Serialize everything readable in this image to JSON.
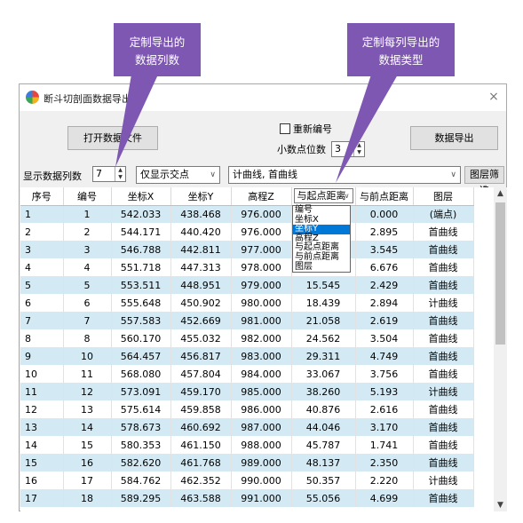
{
  "callouts": {
    "columns": {
      "line1": "定制导出的",
      "line2": "数据列数"
    },
    "types": {
      "line1": "定制每列导出的",
      "line2": "数据类型"
    }
  },
  "window": {
    "title": "断斗切剖面数据导出V",
    "close": "×"
  },
  "toolbar": {
    "open_label": "打开数据文件",
    "renumber_label": "重新编号",
    "decimals_label": "小数点位数",
    "decimals_value": "3",
    "export_label": "数据导出"
  },
  "filters": {
    "columns_label": "显示数据列数",
    "columns_value": "7",
    "point_filter": "仅显示交点",
    "layer_filter": "计曲线, 首曲线",
    "layer_filter_button": "图层筛选"
  },
  "table": {
    "headers": [
      "序号",
      "编号",
      "坐标X",
      "坐标Y",
      "高程Z",
      "与起点距离",
      "与前点距离",
      "图层"
    ],
    "rows": [
      [
        "1",
        "1",
        "542.033",
        "438.468",
        "976.000",
        "",
        "0.000",
        "(端点)"
      ],
      [
        "2",
        "2",
        "544.171",
        "440.420",
        "976.000",
        "",
        "2.895",
        "首曲线"
      ],
      [
        "3",
        "3",
        "546.788",
        "442.811",
        "977.000",
        "",
        "3.545",
        "首曲线"
      ],
      [
        "4",
        "4",
        "551.718",
        "447.313",
        "978.000",
        "",
        "6.676",
        "首曲线"
      ],
      [
        "5",
        "5",
        "553.511",
        "448.951",
        "979.000",
        "15.545",
        "2.429",
        "首曲线"
      ],
      [
        "6",
        "6",
        "555.648",
        "450.902",
        "980.000",
        "18.439",
        "2.894",
        "计曲线"
      ],
      [
        "7",
        "7",
        "557.583",
        "452.669",
        "981.000",
        "21.058",
        "2.619",
        "首曲线"
      ],
      [
        "8",
        "8",
        "560.170",
        "455.032",
        "982.000",
        "24.562",
        "3.504",
        "首曲线"
      ],
      [
        "9",
        "10",
        "564.457",
        "456.817",
        "983.000",
        "29.311",
        "4.749",
        "首曲线"
      ],
      [
        "10",
        "11",
        "568.080",
        "457.804",
        "984.000",
        "33.067",
        "3.756",
        "首曲线"
      ],
      [
        "11",
        "12",
        "573.091",
        "459.170",
        "985.000",
        "38.260",
        "5.193",
        "计曲线"
      ],
      [
        "12",
        "13",
        "575.614",
        "459.858",
        "986.000",
        "40.876",
        "2.616",
        "首曲线"
      ],
      [
        "13",
        "14",
        "578.673",
        "460.692",
        "987.000",
        "44.046",
        "3.170",
        "首曲线"
      ],
      [
        "14",
        "15",
        "580.353",
        "461.150",
        "988.000",
        "45.787",
        "1.741",
        "首曲线"
      ],
      [
        "15",
        "16",
        "582.620",
        "461.768",
        "989.000",
        "48.137",
        "2.350",
        "首曲线"
      ],
      [
        "16",
        "17",
        "584.762",
        "462.352",
        "990.000",
        "50.357",
        "2.220",
        "计曲线"
      ],
      [
        "17",
        "18",
        "589.295",
        "463.588",
        "991.000",
        "55.056",
        "4.699",
        "首曲线"
      ]
    ]
  },
  "dropdown": {
    "options": [
      "编号",
      "坐标X",
      "坐标Y",
      "高程Z",
      "与起点距离",
      "与前点距离",
      "图层"
    ],
    "selected_index": 2
  },
  "colors": {
    "callout": "#7e57b3",
    "row_stripe": "#d3eaf5",
    "selection": "#0078d7"
  }
}
